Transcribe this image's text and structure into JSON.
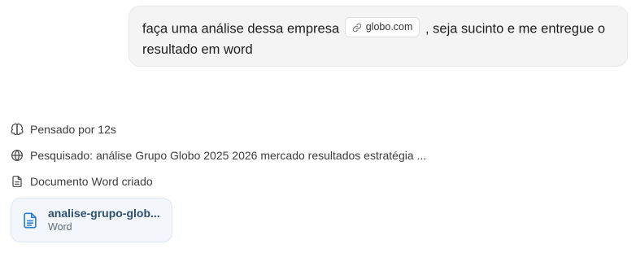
{
  "user_message": {
    "text_before": "faça uma análise dessa empresa",
    "link_chip": "globo.com",
    "text_after": ", seja sucinto e me entregue o resultado em word"
  },
  "steps": [
    {
      "icon": "brain-icon",
      "label": "Pensado por 12s"
    },
    {
      "icon": "globe-icon",
      "label": "Pesquisado: análise Grupo Globo 2025 2026 mercado resultados estratégia ..."
    },
    {
      "icon": "document-icon",
      "label": "Documento Word criado"
    }
  ],
  "file_card": {
    "icon": "word-document-icon",
    "name": "analise-grupo-glob...",
    "type": "Word",
    "accent_color": "#2f7fd0"
  }
}
